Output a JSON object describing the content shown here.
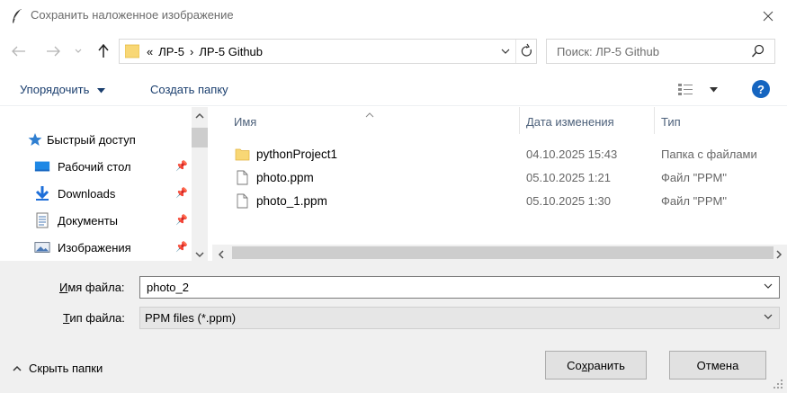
{
  "window": {
    "title": "Сохранить наложенное изображение"
  },
  "nav": {
    "address": {
      "prefix": "«",
      "segments": [
        "ЛР-5",
        "ЛР-5 Github"
      ],
      "separator": "›"
    },
    "search_placeholder": "Поиск: ЛР-5 Github"
  },
  "toolbar": {
    "organize_label": "Упорядочить",
    "new_folder_label": "Создать папку",
    "help_label": "?"
  },
  "sidebar": {
    "quick_access": "Быстрый доступ",
    "items": [
      {
        "label": "Рабочий стол",
        "icon": "desktop-icon"
      },
      {
        "label": "Downloads",
        "icon": "downloads-icon"
      },
      {
        "label": "Документы",
        "icon": "documents-icon"
      },
      {
        "label": "Изображения",
        "icon": "pictures-icon"
      }
    ]
  },
  "file_list": {
    "columns": {
      "name": "Имя",
      "date": "Дата изменения",
      "type": "Тип"
    },
    "rows": [
      {
        "name": "pythonProject1",
        "date": "04.10.2025 15:43",
        "type": "Папка с файлами",
        "kind": "folder"
      },
      {
        "name": "photo.ppm",
        "date": "05.10.2025 1:21",
        "type": "Файл \"PPM\"",
        "kind": "file"
      },
      {
        "name": "photo_1.ppm",
        "date": "05.10.2025 1:30",
        "type": "Файл \"PPM\"",
        "kind": "file"
      }
    ]
  },
  "form": {
    "filename_label_u": "И",
    "filename_label_rest": "мя файла:",
    "filename_value": "photo_2",
    "filetype_label_u": "Т",
    "filetype_label_rest": "ип файла:",
    "filetype_value": "PPM files (*.ppm)"
  },
  "footer": {
    "hide_folders_label": "Скрыть папки",
    "save_label_pre": "Со",
    "save_label_u": "х",
    "save_label_post": "ранить",
    "cancel_label": "Отмена"
  },
  "colors": {
    "folder": "#f8d775",
    "accent_blue": "#1565c0",
    "link_text": "#1a3e6e"
  }
}
